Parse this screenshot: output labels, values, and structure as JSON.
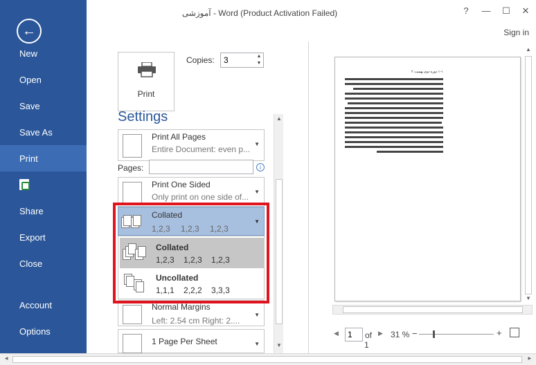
{
  "window": {
    "title": "آموزشی - Word (Product Activation Failed)",
    "help": "?",
    "minimize": "—",
    "maximize": "☐",
    "close": "✕",
    "signin": "Sign in"
  },
  "sidebar": {
    "back_icon": "←",
    "items": [
      {
        "label": "New"
      },
      {
        "label": "Open"
      },
      {
        "label": "Save"
      },
      {
        "label": "Save As"
      },
      {
        "label": "Print",
        "active": true
      },
      {
        "label": ""
      },
      {
        "label": "Share"
      },
      {
        "label": "Export"
      },
      {
        "label": "Close"
      },
      {
        "label": "Account"
      },
      {
        "label": "Options"
      }
    ]
  },
  "print": {
    "button_label": "Print",
    "copies_label": "Copies:",
    "copies_value": "3",
    "settings_title": "Settings",
    "pages_label": "Pages:",
    "pages_value": "",
    "print_range": {
      "main": "Print All Pages",
      "sub": "Entire Document: even p..."
    },
    "sides": {
      "main": "Print One Sided",
      "sub": "Only print on one side of..."
    },
    "collation": {
      "main": "Collated",
      "sub": "1,2,3 1,2,3 1,2,3"
    },
    "collation_options": [
      {
        "main": "Collated",
        "sub": "1,2,3 1,2,3 1,2,3",
        "selected": true
      },
      {
        "main": "Uncollated",
        "sub": "1,1,1 2,2,2 3,3,3",
        "selected": false
      }
    ],
    "margins": {
      "main": "Normal Margins",
      "sub": "Left: 2.54 cm Right: 2...."
    },
    "per_sheet": {
      "main": "1 Page Per Sheet"
    }
  },
  "preview": {
    "heading": "۱-۱ دوره دوم بهمیت ۲",
    "page_value": "1",
    "of_label": "of",
    "total_pages": "1",
    "zoom": "31 %",
    "zoom_minus": "−",
    "zoom_plus": "+",
    "prev": "◀",
    "next": "▶"
  },
  "colors": {
    "accent": "#2b579a",
    "highlight": "#e0141e",
    "selection": "#a8c0e0"
  }
}
